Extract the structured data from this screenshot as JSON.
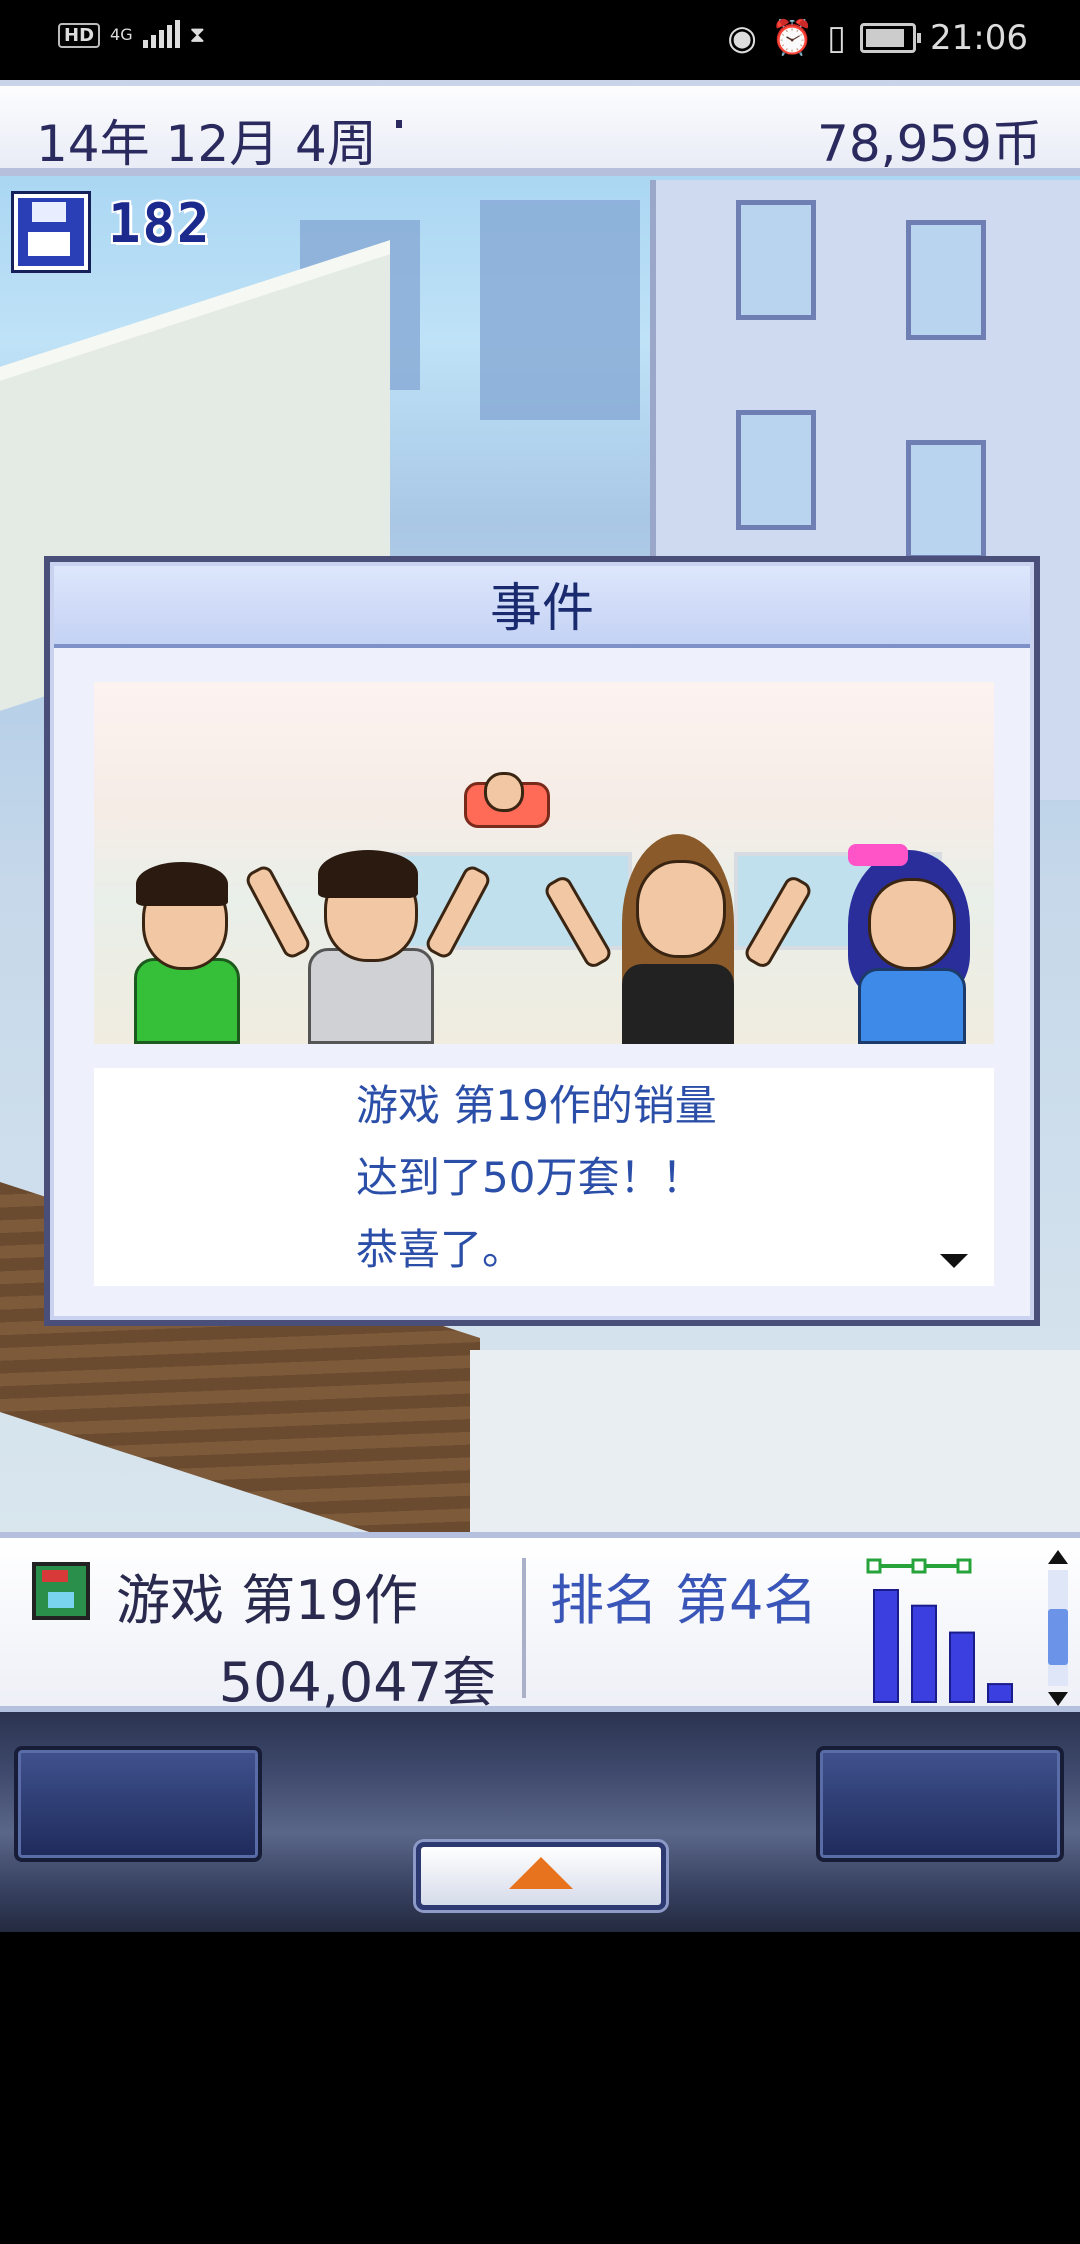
{
  "status_bar": {
    "hd": "HD",
    "network": "4G",
    "time": "21:06"
  },
  "top_bar": {
    "date": "14年 12月 4周",
    "money": "78,959币"
  },
  "save": {
    "count": "182"
  },
  "event_dialog": {
    "title": "事件",
    "lines": [
      "游戏 第19作的销量",
      "达到了50万套！！",
      "恭喜了。"
    ]
  },
  "info_bar": {
    "game_name": "游戏 第19作",
    "sales": "504,047套",
    "rank": "排名 第4名",
    "mini_chart_values": [
      100,
      86,
      62,
      16
    ],
    "scroll_position": 0.65
  },
  "colors": {
    "accent_blue": "#3a55b8",
    "text_dark": "#2b2a5e",
    "dialog_text": "#2b4fa8",
    "chart_bar": "#3b3fe0",
    "chart_line": "#27a33b",
    "menu_arrow": "#e8731e"
  }
}
